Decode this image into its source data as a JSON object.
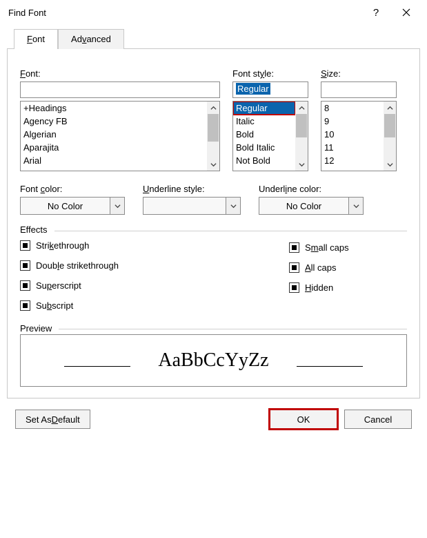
{
  "titlebar": {
    "title": "Find Font",
    "help": "?"
  },
  "tabs": {
    "font": "Font",
    "advanced": "Advanced"
  },
  "labels": {
    "font": "Font:",
    "font_style": "Font style:",
    "size": "Size:",
    "font_color": "Font color:",
    "underline_style": "Underline style:",
    "underline_color": "Underline color:",
    "effects": "Effects",
    "preview": "Preview"
  },
  "font": {
    "value": "",
    "items": [
      "+Headings",
      "Agency FB",
      "Algerian",
      "Aparajita",
      "Arial"
    ]
  },
  "font_style": {
    "value": "Regular",
    "items": [
      "Regular",
      "Italic",
      "Bold",
      "Bold Italic",
      "Not Bold"
    ],
    "selected_index": 0
  },
  "size": {
    "value": "",
    "items": [
      "8",
      "9",
      "10",
      "11",
      "12"
    ]
  },
  "dropdowns": {
    "font_color": "No Color",
    "underline_style": "",
    "underline_color": "No Color"
  },
  "effects": {
    "left": [
      {
        "pre": "Stri",
        "u": "k",
        "post": "ethrough"
      },
      {
        "pre": "Doub",
        "u": "l",
        "post": "e strikethrough"
      },
      {
        "pre": "Su",
        "u": "p",
        "post": "erscript"
      },
      {
        "pre": "Su",
        "u": "b",
        "post": "script"
      }
    ],
    "right": [
      {
        "pre": "S",
        "u": "m",
        "post": "all caps"
      },
      {
        "pre": "",
        "u": "A",
        "post": "ll caps"
      },
      {
        "pre": "",
        "u": "H",
        "post": "idden"
      }
    ]
  },
  "preview_text": "AaBbCcYyZz",
  "buttons": {
    "set_default": "Set As Default",
    "ok": "OK",
    "cancel": "Cancel"
  }
}
